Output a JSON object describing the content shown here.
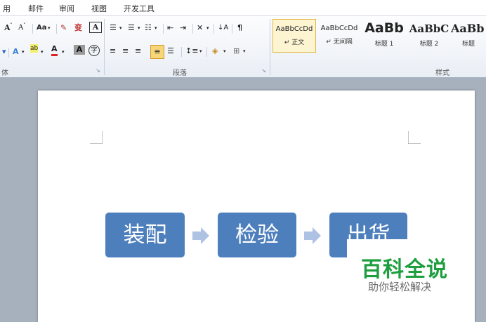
{
  "menubar": {
    "items": [
      "用",
      "邮件",
      "审阅",
      "视图",
      "开发工具"
    ]
  },
  "ribbon": {
    "font_group": {
      "label": "体",
      "row1": {
        "grow_font": "A",
        "shrink_font": "A",
        "change_case": "Aa",
        "clear_format": "✎",
        "phonetic": "变",
        "char_border": "A"
      },
      "row2": {
        "text_effect": "A",
        "highlight": "ab",
        "font_color": "A",
        "char_shading": "A",
        "enclose_char": "字"
      }
    },
    "paragraph_group": {
      "label": "段落"
    },
    "styles_group": {
      "label": "样式",
      "items": [
        {
          "sample": "AaBbCcDd",
          "name": "↵ 正文"
        },
        {
          "sample": "AaBbCcDd",
          "name": "↵ 无间隔"
        },
        {
          "sample": "AaBb",
          "name": "标题 1"
        },
        {
          "sample": "AaBbC",
          "name": "标题 2"
        },
        {
          "sample": "AaBb",
          "name": "标题"
        }
      ]
    }
  },
  "diagram": {
    "steps": [
      "装配",
      "检验",
      "出货"
    ]
  },
  "watermark": {
    "title": "百科全说",
    "subtitle": "助你轻松解决"
  },
  "colors": {
    "step_fill": "#4e7fbd",
    "arrow_fill": "#aec3e3",
    "watermark_green": "#1e9e3e",
    "active_style_border": "#e2b640"
  }
}
